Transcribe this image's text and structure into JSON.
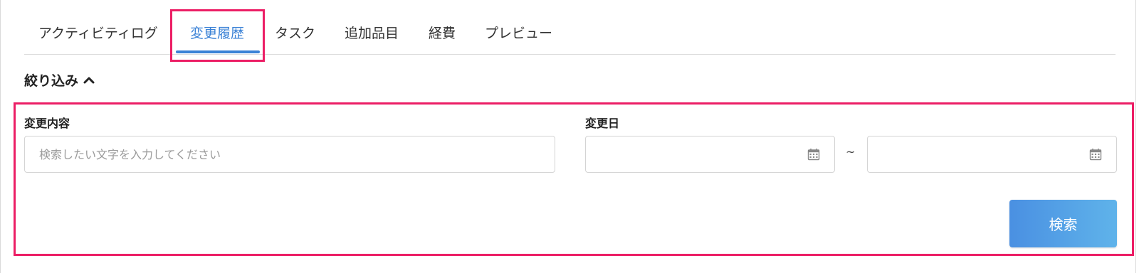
{
  "tabs": [
    {
      "label": "アクティビティログ",
      "active": false
    },
    {
      "label": "変更履歴",
      "active": true
    },
    {
      "label": "タスク",
      "active": false
    },
    {
      "label": "追加品目",
      "active": false
    },
    {
      "label": "経費",
      "active": false
    },
    {
      "label": "プレビュー",
      "active": false
    }
  ],
  "filter": {
    "toggle_label": "絞り込み",
    "expanded": true,
    "change_content": {
      "label": "変更内容",
      "value": "",
      "placeholder": "検索したい文字を入力してください"
    },
    "change_date": {
      "label": "変更日",
      "from_value": "",
      "to_value": "",
      "separator": "~"
    },
    "search_label": "検索"
  },
  "colors": {
    "accent": "#3b82d6",
    "highlight": "#ec1e65",
    "button_start": "#4a90e2",
    "button_end": "#5fb3ea"
  },
  "icons": {
    "filter_toggle": "chevron-up-icon",
    "date_picker": "calendar-icon"
  }
}
